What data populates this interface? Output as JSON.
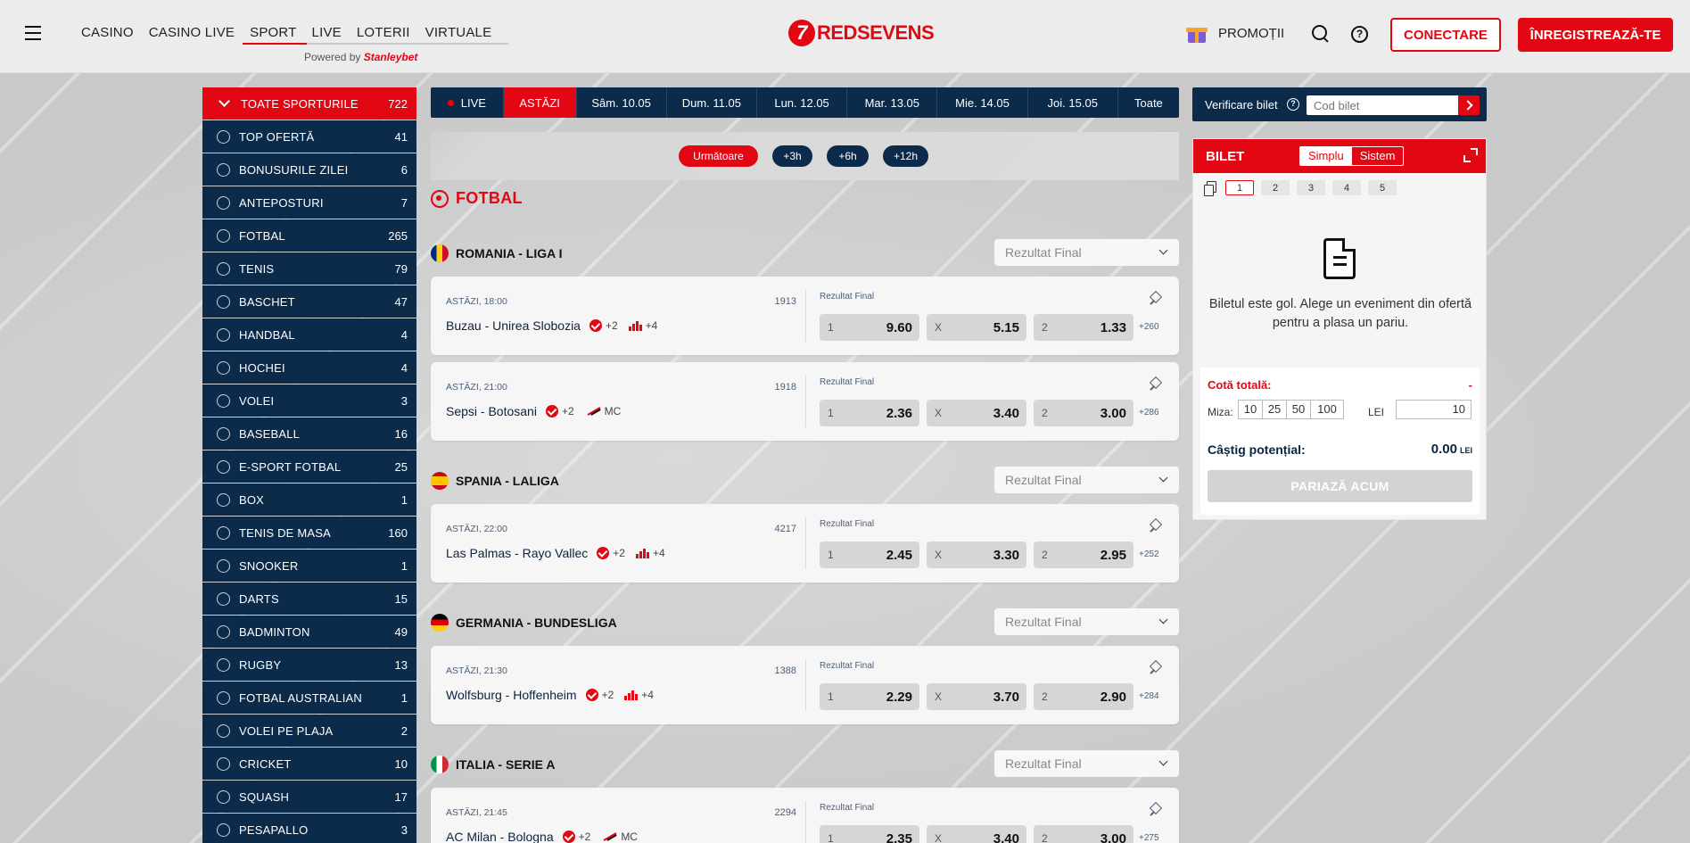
{
  "header": {
    "nav": [
      "CASINO",
      "CASINO LIVE",
      "SPORT",
      "LIVE",
      "LOTERII",
      "VIRTUALE"
    ],
    "active_nav": "SPORT",
    "powered_by": "Powered by",
    "powered_brand": "Stanleybet",
    "logo_mark": "7",
    "logo_text": "REDSEVENS",
    "promo_label": "PROMOȚII",
    "login_label": "CONECTARE",
    "register_label": "ÎNREGISTREAZĂ-TE"
  },
  "sidebar": {
    "items": [
      {
        "label": "TOATE SPORTURILE",
        "count": "722"
      },
      {
        "label": "TOP OFERTĂ",
        "count": "41"
      },
      {
        "label": "BONUSURILE ZILEI",
        "count": "6"
      },
      {
        "label": "ANTEPOSTURI",
        "count": "7"
      },
      {
        "label": "FOTBAL",
        "count": "265"
      },
      {
        "label": "TENIS",
        "count": "79"
      },
      {
        "label": "BASCHET",
        "count": "47"
      },
      {
        "label": "HANDBAL",
        "count": "4"
      },
      {
        "label": "HOCHEI",
        "count": "4"
      },
      {
        "label": "VOLEI",
        "count": "3"
      },
      {
        "label": "BASEBALL",
        "count": "16"
      },
      {
        "label": "E-SPORT FOTBAL",
        "count": "25"
      },
      {
        "label": "BOX",
        "count": "1"
      },
      {
        "label": "TENIS DE MASA",
        "count": "160"
      },
      {
        "label": "SNOOKER",
        "count": "1"
      },
      {
        "label": "DARTS",
        "count": "15"
      },
      {
        "label": "BADMINTON",
        "count": "49"
      },
      {
        "label": "RUGBY",
        "count": "13"
      },
      {
        "label": "FOTBAL AUSTRALIAN",
        "count": "1"
      },
      {
        "label": "VOLEI PE PLAJA",
        "count": "2"
      },
      {
        "label": "CRICKET",
        "count": "10"
      },
      {
        "label": "SQUASH",
        "count": "17"
      },
      {
        "label": "PESAPALLO",
        "count": "3"
      }
    ]
  },
  "dates": {
    "live": "LIVE",
    "today": "ASTĂZI",
    "days": [
      "Sâm. 10.05",
      "Dum. 11.05",
      "Lun. 12.05",
      "Mar. 13.05",
      "Mie. 14.05",
      "Joi. 15.05"
    ],
    "all": "Toate"
  },
  "filters": [
    "Următoare",
    "+3h",
    "+6h",
    "+12h"
  ],
  "sport_title": "FOTBAL",
  "leagues": [
    {
      "name": "ROMANIA - LIGA I",
      "market": "Rezultat Final"
    },
    {
      "name": "SPANIA - LALIGA",
      "market": "Rezultat Final"
    },
    {
      "name": "GERMANIA - BUNDESLIGA",
      "market": "Rezultat Final"
    },
    {
      "name": "ITALIA - SERIE A",
      "market": "Rezultat Final"
    }
  ],
  "matches": [
    {
      "time": "ASTĂZI, 18:00",
      "code": "1913",
      "teams": "Buzau - Unirea Slobozia",
      "plus": "+2",
      "extra": "+4",
      "market": "Rezultat Final",
      "o1": "9.60",
      "ox": "5.15",
      "o2": "1.33",
      "more": "+260",
      "l1": "1",
      "lx": "X",
      "l2": "2"
    },
    {
      "time": "ASTĂZI, 21:00",
      "code": "1918",
      "teams": "Sepsi - Botosani",
      "plus": "+2",
      "extra": "MC",
      "market": "Rezultat Final",
      "o1": "2.36",
      "ox": "3.40",
      "o2": "3.00",
      "more": "+286",
      "l1": "1",
      "lx": "X",
      "l2": "2"
    },
    {
      "time": "ASTĂZI, 22:00",
      "code": "4217",
      "teams": "Las Palmas - Rayo Vallec",
      "plus": "+2",
      "extra": "+4",
      "market": "Rezultat Final",
      "o1": "2.45",
      "ox": "3.30",
      "o2": "2.95",
      "more": "+252",
      "l1": "1",
      "lx": "X",
      "l2": "2"
    },
    {
      "time": "ASTĂZI, 21:30",
      "code": "1388",
      "teams": "Wolfsburg - Hoffenheim",
      "plus": "+2",
      "extra": "+4",
      "market": "Rezultat Final",
      "o1": "2.29",
      "ox": "3.70",
      "o2": "2.90",
      "more": "+284",
      "l1": "1",
      "lx": "X",
      "l2": "2"
    },
    {
      "time": "ASTĂZI, 21:45",
      "code": "2294",
      "teams": "AC Milan - Bologna",
      "plus": "+2",
      "extra": "MC",
      "market": "Rezultat Final",
      "o1": "2.35",
      "ox": "3.40",
      "o2": "3.00",
      "more": "+275",
      "l1": "1",
      "lx": "X",
      "l2": "2"
    }
  ],
  "ticket_check": {
    "label": "Verificare bilet",
    "placeholder": "Cod bilet"
  },
  "bilet": {
    "title": "BILET",
    "mode_simple": "Simplu",
    "mode_system": "Sistem",
    "pages": [
      "1",
      "2",
      "3",
      "4",
      "5"
    ],
    "empty_text": "Biletul este gol. Alege un eveniment din ofertă pentru a plasa un pariu.",
    "total_odds_label": "Cotă totală:",
    "total_odds_value": "-",
    "stake_label": "Miza:",
    "stakes": [
      "10",
      "25",
      "50",
      "100"
    ],
    "currency_label": "LEI",
    "stake_value": "10",
    "potential_label": "Câștig potențial:",
    "potential_value": "0.00",
    "potential_currency": "LEI",
    "bet_button": "PARIAZĂ ACUM"
  },
  "colors": {
    "brand_red": "#e30613",
    "navy": "#0c2a4a"
  }
}
